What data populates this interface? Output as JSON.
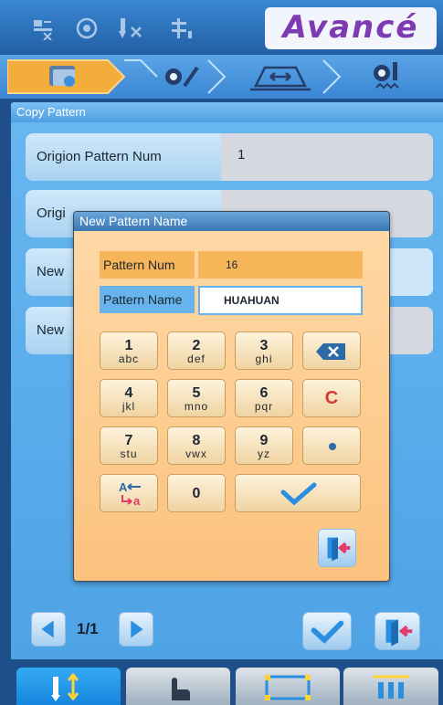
{
  "brand": "Avancé",
  "panel": {
    "title": "Copy Pattern",
    "rows": [
      {
        "label": "Origion Pattern Num",
        "value": "1"
      },
      {
        "label": "Origi",
        "value": ""
      },
      {
        "label": "New",
        "value": ""
      },
      {
        "label": "New",
        "value": ""
      }
    ]
  },
  "pager": {
    "indicator": "1/1"
  },
  "dialog": {
    "title": "New Pattern Name",
    "pattern_num_label": "Pattern Num",
    "pattern_num_value": "16",
    "pattern_name_label": "Pattern Name",
    "pattern_name_value": "HUAHUAN",
    "keys": [
      {
        "digit": "1",
        "letters": "abc"
      },
      {
        "digit": "2",
        "letters": "def"
      },
      {
        "digit": "3",
        "letters": "ghi"
      },
      {
        "digit": "4",
        "letters": "jkl"
      },
      {
        "digit": "5",
        "letters": "mno"
      },
      {
        "digit": "6",
        "letters": "pqr"
      },
      {
        "digit": "7",
        "letters": "stu"
      },
      {
        "digit": "8",
        "letters": "vwx"
      },
      {
        "digit": "9",
        "letters": "yz"
      },
      {
        "digit": "0",
        "letters": ""
      }
    ],
    "clear_label": "C"
  },
  "colors": {
    "accent": "#2b8fe0",
    "dialog_bg": "#fbc27e",
    "check": "#2a8fe0",
    "exit_arrow": "#e23a6b",
    "clear": "#d8383a"
  }
}
